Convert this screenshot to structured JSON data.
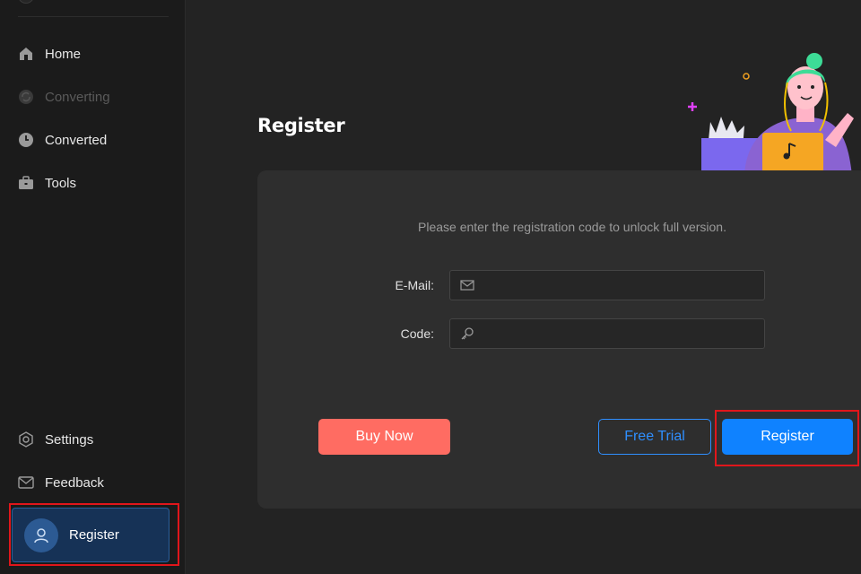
{
  "sidebar": {
    "items": [
      {
        "label": "Home",
        "icon": "home-icon"
      },
      {
        "label": "Converting",
        "icon": "converting-icon",
        "state": "disabled"
      },
      {
        "label": "Converted",
        "icon": "clock-icon"
      },
      {
        "label": "Tools",
        "icon": "toolbox-icon"
      }
    ],
    "bottom": [
      {
        "label": "Settings",
        "icon": "gear-icon"
      },
      {
        "label": "Feedback",
        "icon": "mail-icon"
      }
    ],
    "register": {
      "label": "Register",
      "icon": "user-icon"
    }
  },
  "main": {
    "title": "Register",
    "instruction": "Please enter the registration code to unlock full version.",
    "email": {
      "label": "E-Mail:",
      "value": "",
      "icon": "envelope-icon"
    },
    "code": {
      "label": "Code:",
      "value": "",
      "icon": "key-icon"
    },
    "buttons": {
      "buy": "Buy Now",
      "trial": "Free Trial",
      "register": "Register"
    }
  },
  "colors": {
    "background": "#232323",
    "sidebar": "#1b1b1b",
    "card": "#2e2e2e",
    "buy_button": "#ff6c62",
    "primary": "#0f82ff",
    "highlight": "#e1161b"
  }
}
